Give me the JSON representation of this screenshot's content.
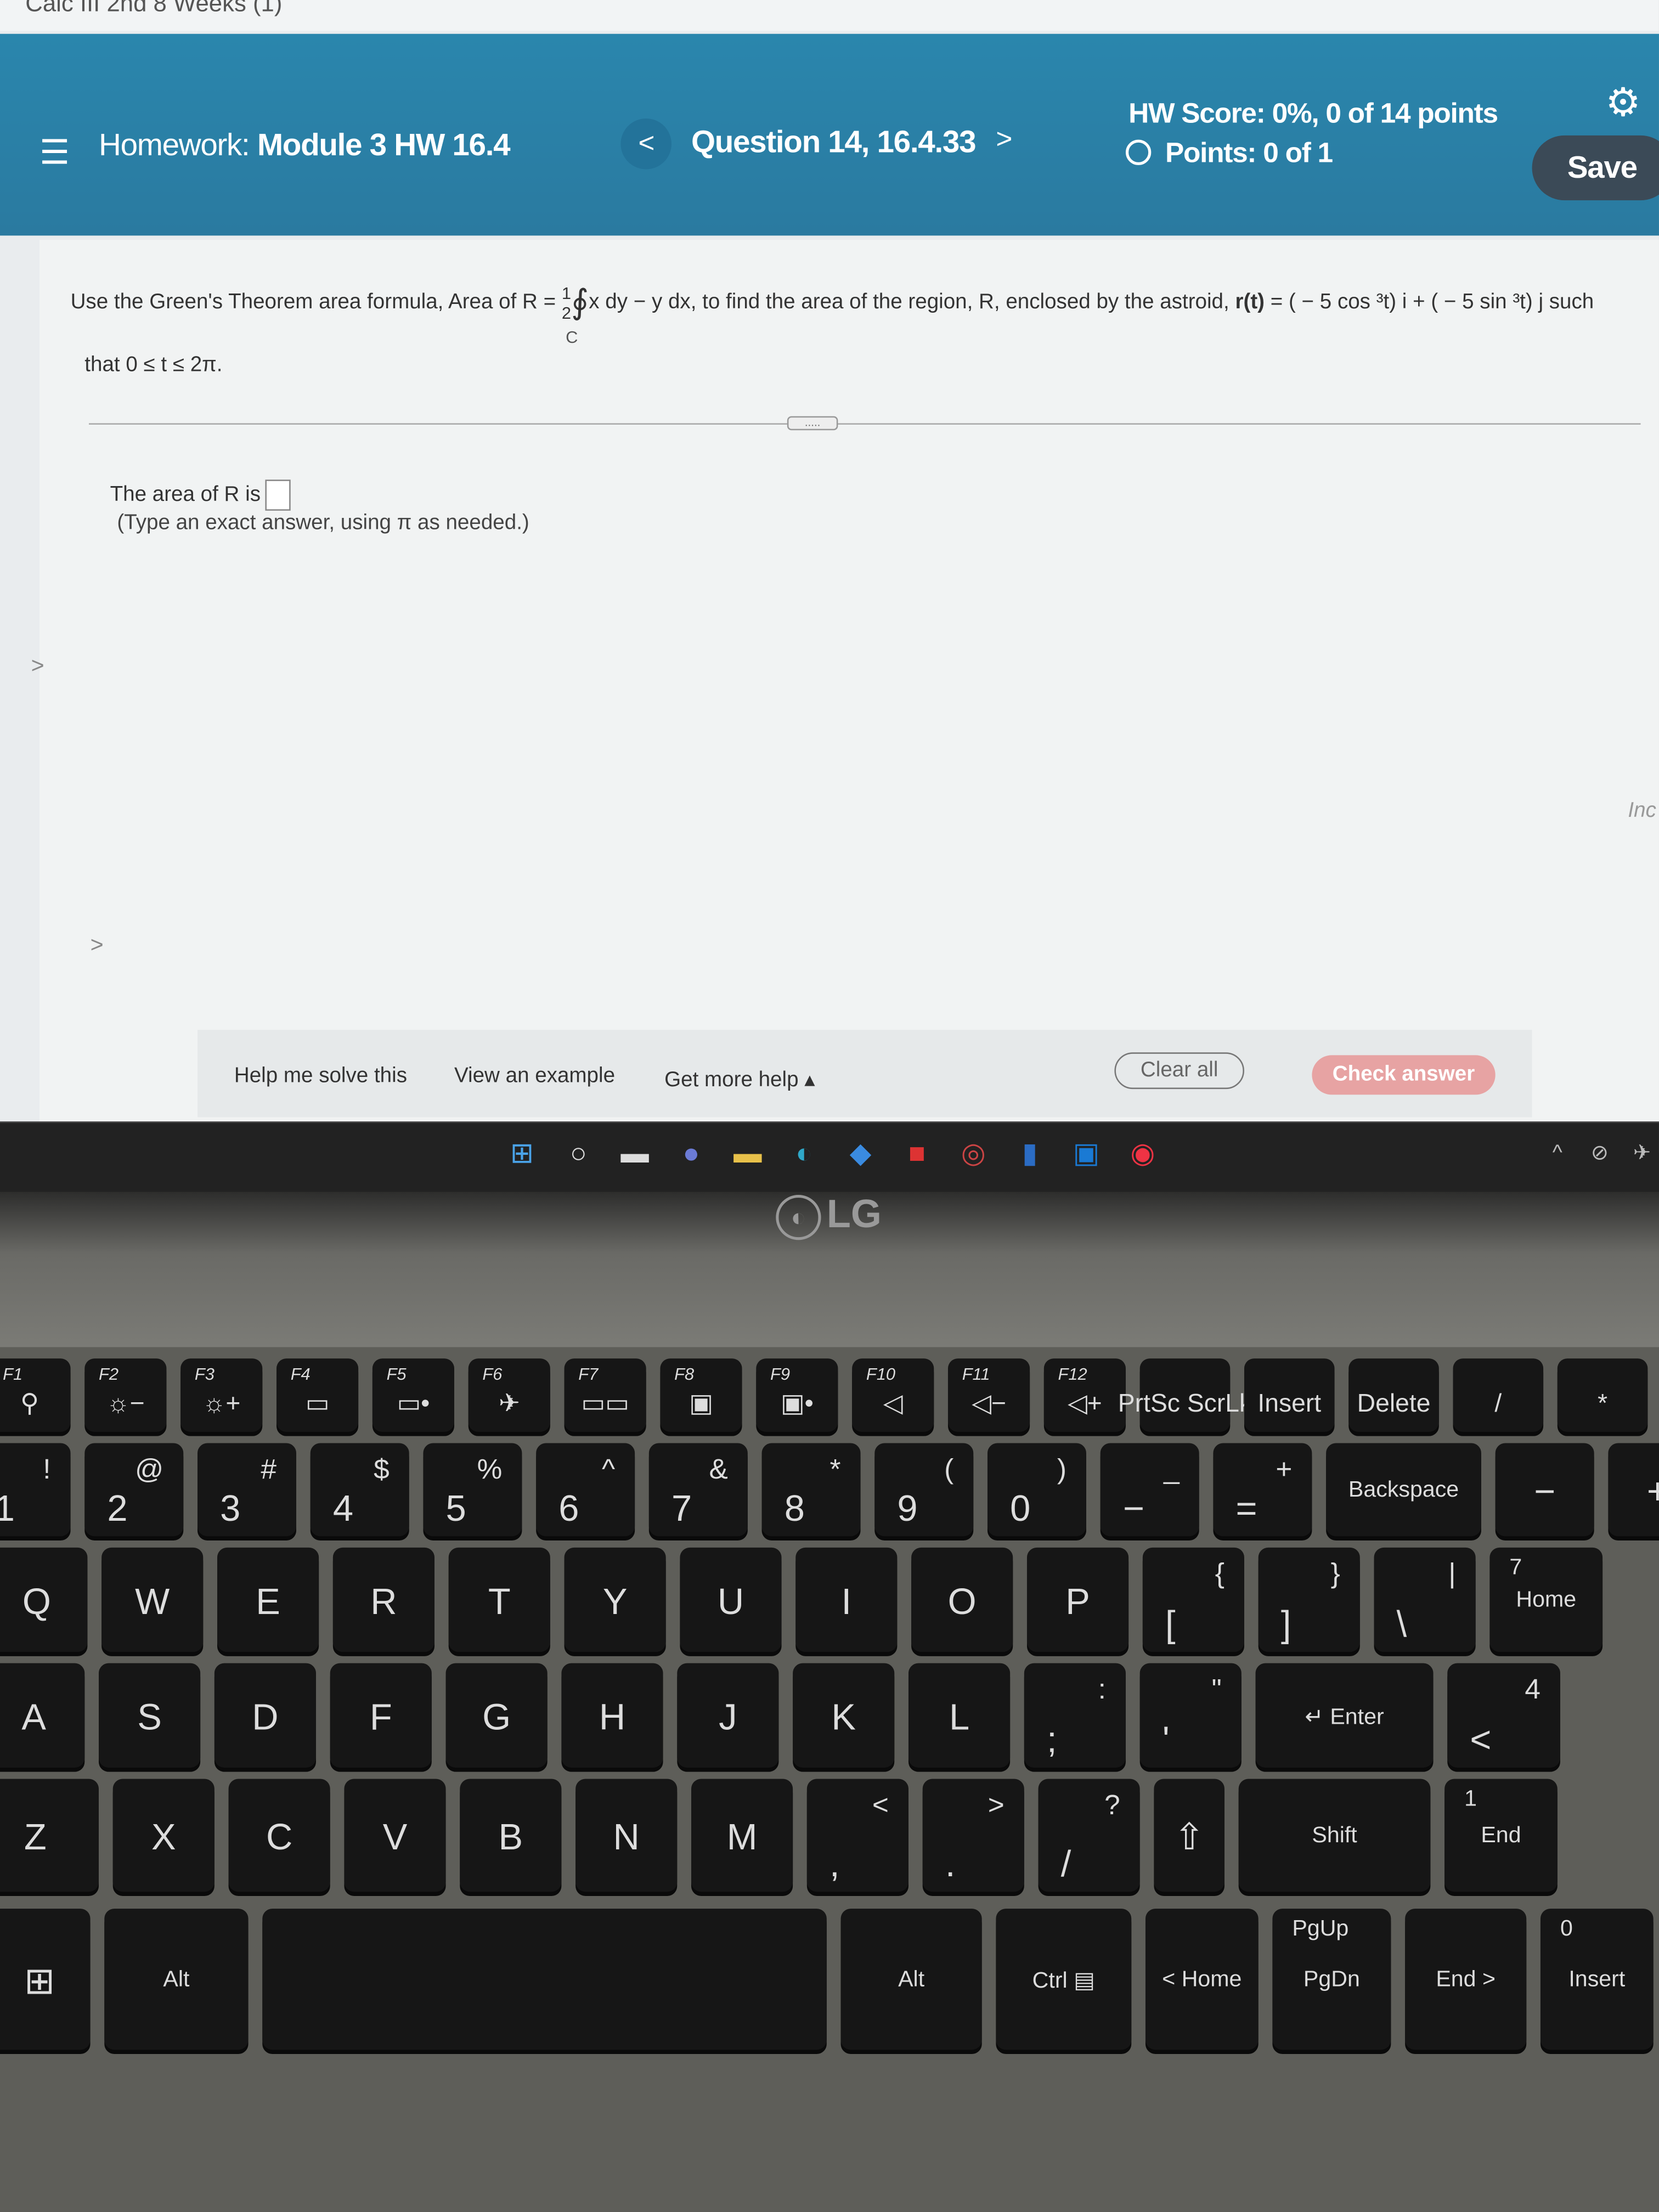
{
  "browser_tab": {
    "title": "Calc III 2nd 8 Weeks (1)"
  },
  "header": {
    "menu_icon": "hamburger-icon",
    "homework_prefix": "Homework:",
    "homework_name": "Module 3 HW 16.4",
    "prev_label": "<",
    "question_title": "Question 14, 16.4.33",
    "next_label": ">",
    "hw_score": "HW Score: 0%, 0 of 14 points",
    "points": "Points: 0 of 1",
    "settings_icon": "gear-icon",
    "save_label": "Save",
    "color": "#2a82a8"
  },
  "question": {
    "text_pre": "Use the Green's Theorem area formula, Area of R =",
    "frac_num": "1",
    "frac_den": "2",
    "integral_symbol": "∮",
    "integral_sub": "C",
    "text_post": "x dy − y dx, to find the area of the region, R, enclosed by the astroid, ",
    "r_label": "r(t)",
    "formula": " = ( − 5 cos ³t) i + ( − 5 sin ³t) j such",
    "range": "that 0 ≤ t ≤ 2π.",
    "expand_label": "....."
  },
  "answer": {
    "prompt": "The area of R is",
    "value": "",
    "hint": "(Type an exact answer, using π as needed.)"
  },
  "side": {
    "left_chevron": ">",
    "left_chevron2": ">",
    "right_text": "Inc"
  },
  "footer": {
    "help_solve": "Help me solve this",
    "view_example": "View an example",
    "more_help": "Get more help ▴",
    "clear_all": "Clear all",
    "check_answer": "Check answer",
    "check_color": "#e7a3a3"
  },
  "taskbar": {
    "icons": [
      "windows-start-icon",
      "search-icon",
      "task-view-icon",
      "chat-icon",
      "file-explorer-icon",
      "edge-icon",
      "mail-icon",
      "office-icon",
      "app-icon",
      "monitor-icon",
      "outlook-icon",
      "chrome-icon"
    ],
    "tray": [
      "^",
      "⊘",
      "✈"
    ]
  },
  "bezel": {
    "logo": "LG"
  },
  "keyboard": {
    "rows": [
      [
        [
          "F1",
          "⚲"
        ],
        [
          "F2",
          "☼−"
        ],
        [
          "F3",
          "☼+"
        ],
        [
          "F4",
          "▭"
        ],
        [
          "F5",
          "▭•"
        ],
        [
          "F6",
          "✈"
        ],
        [
          "F7",
          "▭▭"
        ],
        [
          "F8",
          "▣"
        ],
        [
          "F9",
          "▣•"
        ],
        [
          "F10",
          "◁"
        ],
        [
          "F11",
          "◁−"
        ],
        [
          "F12",
          "◁+"
        ],
        [
          "",
          "PrtSc ScrLk"
        ],
        [
          "",
          "Insert"
        ],
        [
          "",
          "Delete"
        ],
        [
          "",
          "/"
        ],
        [
          "",
          "*"
        ]
      ],
      [
        [
          "!",
          "1"
        ],
        [
          "@",
          "2"
        ],
        [
          "#",
          "3"
        ],
        [
          "$",
          "4"
        ],
        [
          "%",
          "5"
        ],
        [
          "^",
          "6"
        ],
        [
          "&",
          "7"
        ],
        [
          "*",
          "8"
        ],
        [
          "(",
          "9"
        ],
        [
          ")",
          "0"
        ],
        [
          "_",
          "−"
        ],
        [
          "+",
          "="
        ],
        [
          "",
          "Backspace"
        ],
        [
          "",
          "−"
        ],
        [
          "",
          "+"
        ]
      ],
      [
        [
          "",
          "Q"
        ],
        [
          "",
          "W"
        ],
        [
          "",
          "E"
        ],
        [
          "",
          "R"
        ],
        [
          "",
          "T"
        ],
        [
          "",
          "Y"
        ],
        [
          "",
          "U"
        ],
        [
          "",
          "I"
        ],
        [
          "",
          "O"
        ],
        [
          "",
          "P"
        ],
        [
          "{",
          "["
        ],
        [
          "}",
          "]"
        ],
        [
          "|",
          "\\"
        ],
        [
          "7",
          "Home"
        ]
      ],
      [
        [
          "",
          "A"
        ],
        [
          "",
          "S"
        ],
        [
          "",
          "D"
        ],
        [
          "",
          "F"
        ],
        [
          "",
          "G"
        ],
        [
          "",
          "H"
        ],
        [
          "",
          "J"
        ],
        [
          "",
          "K"
        ],
        [
          "",
          "L"
        ],
        [
          ":",
          ";"
        ],
        [
          "\"",
          "'"
        ],
        [
          "",
          "↵ Enter"
        ],
        [
          "4",
          "<"
        ]
      ],
      [
        [
          "",
          "Z"
        ],
        [
          "",
          "X"
        ],
        [
          "",
          "C"
        ],
        [
          "",
          "V"
        ],
        [
          "",
          "B"
        ],
        [
          "",
          "N"
        ],
        [
          "",
          "M"
        ],
        [
          "<",
          ","
        ],
        [
          ">",
          "."
        ],
        [
          "?",
          "/"
        ],
        [
          "",
          "⇧"
        ],
        [
          "",
          "Shift"
        ],
        [
          "1",
          "End"
        ]
      ],
      [
        [
          "",
          "⊞"
        ],
        [
          "",
          "Alt"
        ],
        [
          "",
          ""
        ],
        [
          "",
          "Alt"
        ],
        [
          "",
          "Ctrl ▤"
        ],
        [
          "",
          "< Home"
        ],
        [
          "PgUp",
          "PgDn"
        ],
        [
          "",
          "End >"
        ],
        [
          "0",
          "Insert"
        ]
      ]
    ]
  }
}
